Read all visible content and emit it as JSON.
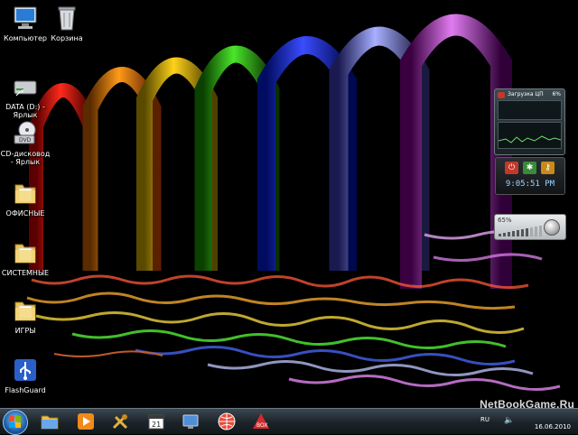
{
  "desktop_icons": [
    {
      "label": "Компьютер",
      "icon": "computer-icon"
    },
    {
      "label": "Корзина",
      "icon": "recycle-bin-icon"
    },
    {
      "label": "DATA (D:) - Ярлык",
      "icon": "drive-icon"
    },
    {
      "label": "CD-дисковод - Ярлык",
      "icon": "dvd-drive-icon"
    },
    {
      "label": "ОФИСНЫЕ",
      "icon": "folder-icon"
    },
    {
      "label": "СИСТЕМНЫЕ",
      "icon": "folder-icon"
    },
    {
      "label": "ИГРЫ",
      "icon": "folder-icon"
    },
    {
      "label": "FlashGuard",
      "icon": "usb-icon"
    }
  ],
  "gadgets": {
    "cpu": {
      "title": "Загрузка ЦП",
      "percent": "6%"
    },
    "clock": {
      "time": "9:05:51 PM"
    },
    "volume": {
      "percent": "65%"
    }
  },
  "taskbar": {
    "buttons": [
      "explorer-icon",
      "media-player-icon",
      "tools-icon",
      "calendar-icon",
      "monitor-icon",
      "globe-icon",
      "apps-icon"
    ],
    "tray": {
      "lang": "RU",
      "date": "16.06.2010"
    }
  },
  "watermark": "NetBookGame.Ru",
  "colors": {
    "taskbar": "#1b2329",
    "clock_text": "#9fd4ff"
  }
}
